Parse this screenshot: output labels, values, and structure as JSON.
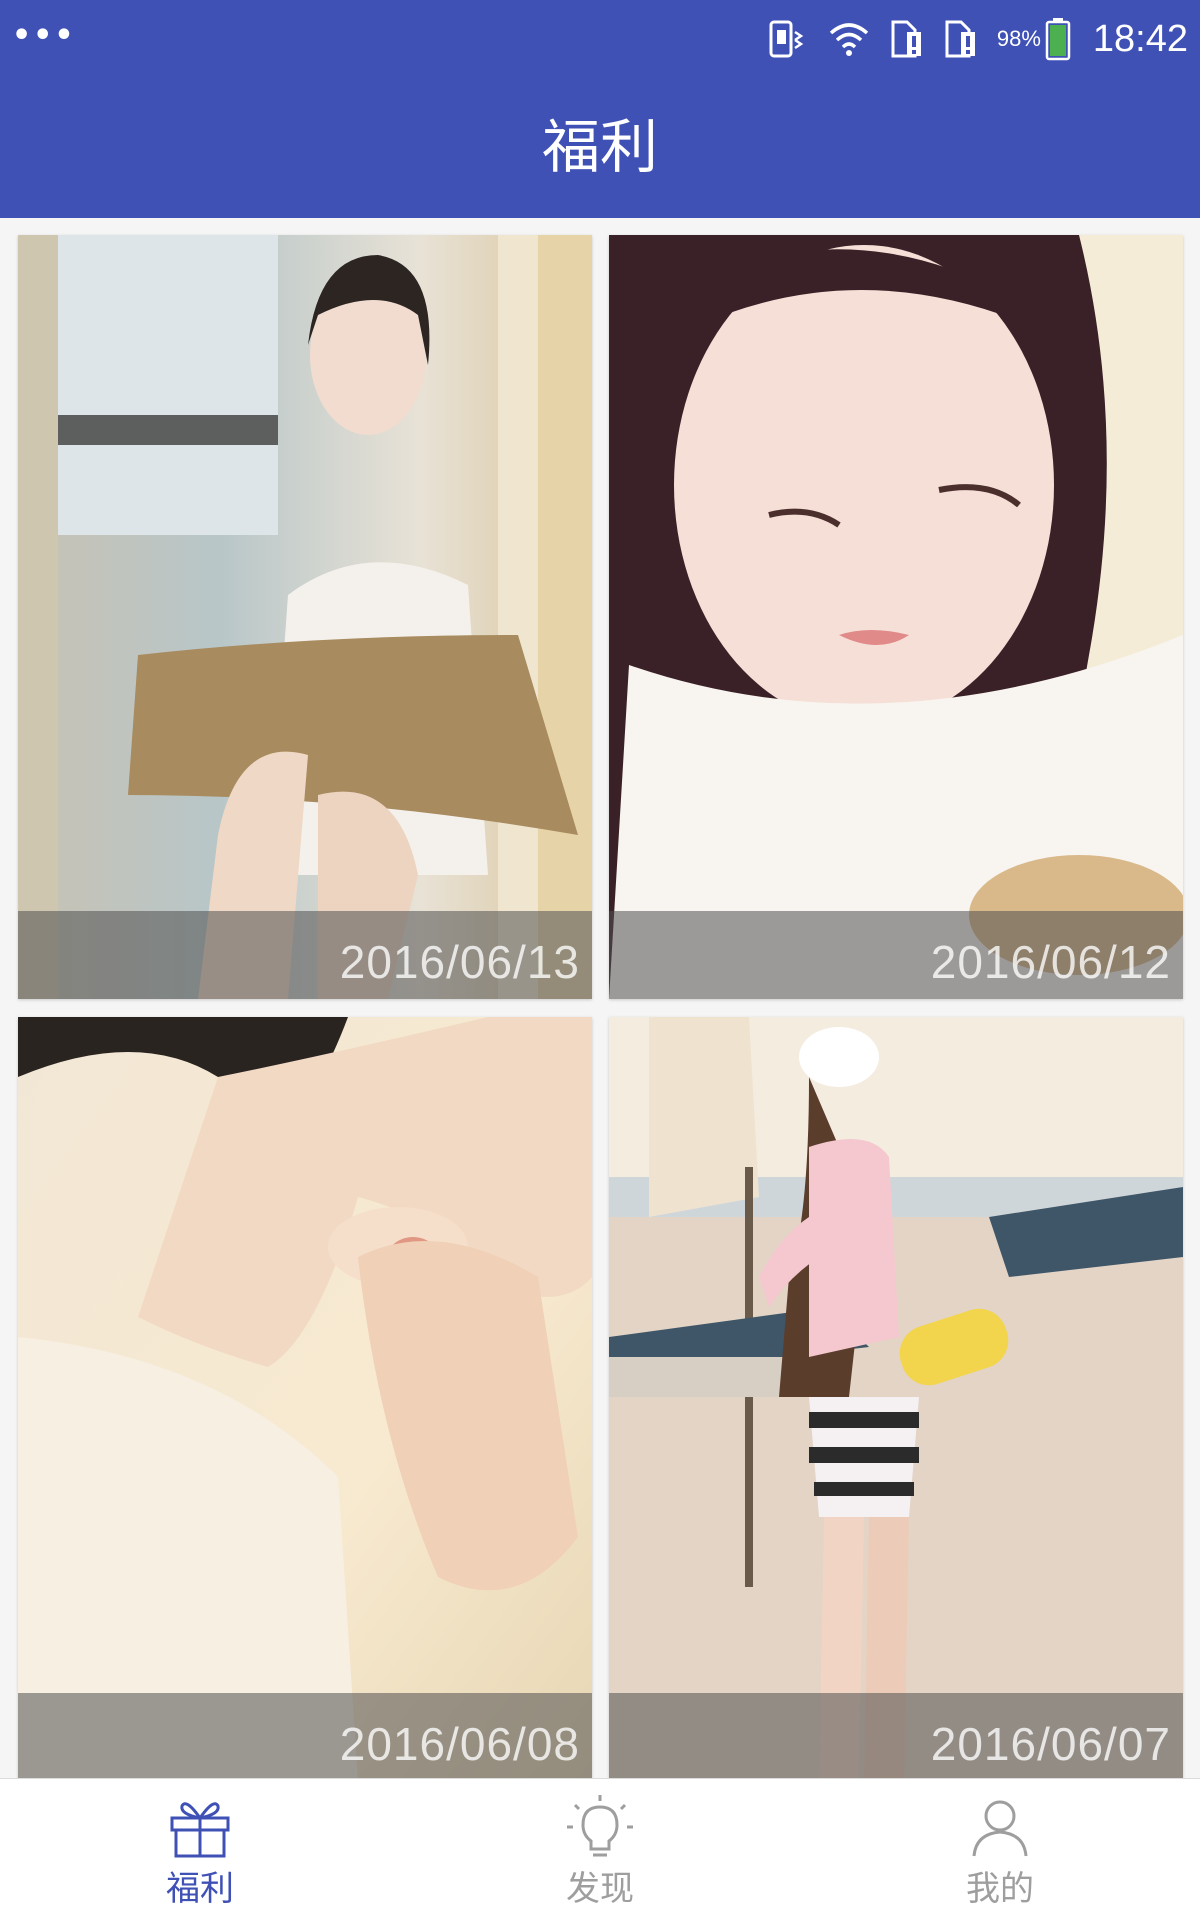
{
  "status_bar": {
    "battery_percent": "98%",
    "time": "18:42",
    "icons": [
      "menu-dots-icon",
      "vibrate-icon",
      "wifi-icon",
      "sim1-alert-icon",
      "sim2-alert-icon",
      "battery-icon"
    ]
  },
  "app_bar": {
    "title": "福利"
  },
  "photos": [
    {
      "date": "2016/06/13"
    },
    {
      "date": "2016/06/12"
    },
    {
      "date": "2016/06/08"
    },
    {
      "date": "2016/06/07"
    }
  ],
  "bottom_nav": {
    "items": [
      {
        "label": "福利",
        "icon": "gift-icon",
        "active": true
      },
      {
        "label": "发现",
        "icon": "lightbulb-icon",
        "active": false
      },
      {
        "label": "我的",
        "icon": "person-icon",
        "active": false
      }
    ]
  },
  "colors": {
    "primary": "#3f51b5",
    "nav_active": "#3f51b5",
    "nav_inactive": "#9e9e9e",
    "battery_green": "#4caf50"
  }
}
